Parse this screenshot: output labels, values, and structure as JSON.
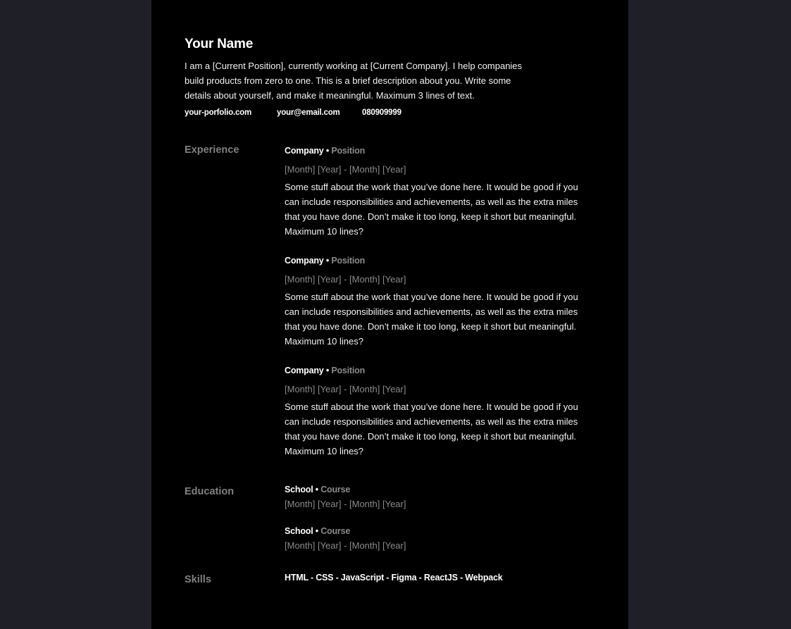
{
  "profile": {
    "name": "Your Name",
    "bio": "I am a [Current Position], currently working at [Current Company]. I help companies build products from zero to one. This is a brief description about you. Write some details about yourself, and make it meaningful. Maximum 3 lines of text.",
    "website": "your-porfolio.com",
    "email": "your@email.com",
    "phone": "080909999"
  },
  "experience": {
    "title": "Experience",
    "entries": [
      {
        "company": "Company",
        "separator": "•",
        "position": "Position",
        "dates": "[Month] [Year] - [Month] [Year]",
        "description": "Some stuff about the work that you’ve done here. It would be good if you can include responsibilities and achievements, as well as the extra miles that you have done. Don’t make it too long, keep it short but meaningful. Maximum 10 lines?"
      },
      {
        "company": "Company",
        "separator": "•",
        "position": "Position",
        "dates": "[Month] [Year] - [Month] [Year]",
        "description": "Some stuff about the work that you’ve done here. It would be good if you can include responsibilities and achievements, as well as the extra miles that you have done. Don’t make it too long, keep it short but meaningful. Maximum 10 lines?"
      },
      {
        "company": "Company",
        "separator": "•",
        "position": "Position",
        "dates": "[Month] [Year] - [Month] [Year]",
        "description": "Some stuff about the work that you’ve done here. It would be good if you can include responsibilities and achievements, as well as the extra miles that you have done. Don’t make it too long, keep it short but meaningful. Maximum 10 lines?"
      }
    ]
  },
  "education": {
    "title": "Education",
    "entries": [
      {
        "school": "School",
        "separator": "•",
        "course": "Course",
        "dates": "[Month] [Year] - [Month] [Year]"
      },
      {
        "school": "School",
        "separator": "•",
        "course": "Course",
        "dates": "[Month] [Year] - [Month] [Year]"
      }
    ]
  },
  "skills": {
    "title": "Skills",
    "list": "HTML - CSS - JavaScript - Figma - ReactJS - Webpack"
  },
  "colors": {
    "background": "#1f1f28",
    "page": "#000000",
    "text": "#ffffff",
    "muted": "#808080"
  }
}
